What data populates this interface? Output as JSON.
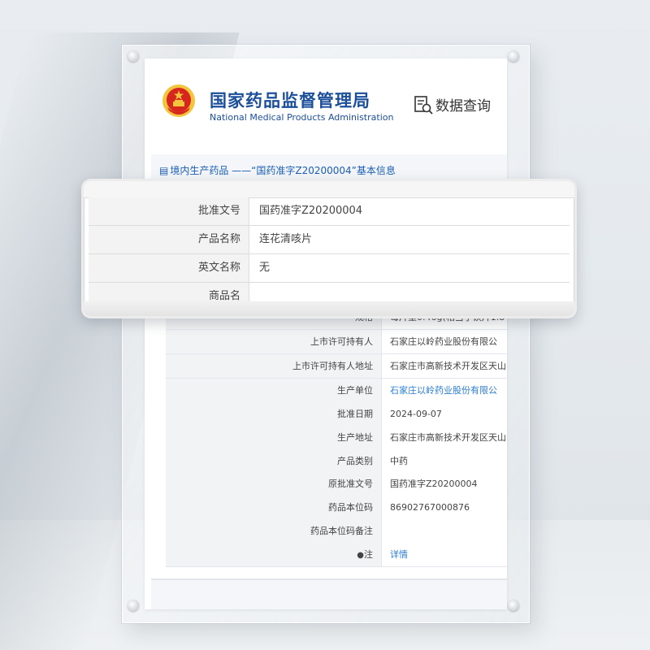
{
  "header": {
    "title_cn": "国家药品监督管理局",
    "title_en": "National Medical Products Administration",
    "query_label": "数据查询",
    "emblem_icon": "national-emblem-icon",
    "query_icon": "document-search-icon"
  },
  "breadcrumb": {
    "text": "境内生产药品 ——“国药准字Z20200004”基本信息",
    "icon": "document-icon"
  },
  "magnified": {
    "rows": [
      {
        "label": "批准文号",
        "value": "国药准字Z20200004"
      },
      {
        "label": "产品名称",
        "value": "连花清咳片"
      },
      {
        "label": "英文名称",
        "value": "无"
      },
      {
        "label": "商品名",
        "value": ""
      }
    ]
  },
  "table": {
    "rows": [
      {
        "label": "规格",
        "value": "每片重0.46g(相当于饮片1.8"
      },
      {
        "label": "上市许可持有人",
        "value": "石家庄以岭药业股份有限公"
      },
      {
        "label": "上市许可持有人地址",
        "value": "石家庄市高新技术开发区天山"
      },
      {
        "label": "生产单位",
        "value": "石家庄以岭药业股份有限公"
      },
      {
        "label": "批准日期",
        "value": "2024-09-07"
      },
      {
        "label": "生产地址",
        "value": "石家庄市高新技术开发区天山"
      },
      {
        "label": "产品类别",
        "value": "中药"
      },
      {
        "label": "原批准文号",
        "value": "国药准字Z20200004"
      },
      {
        "label": "药品本位码",
        "value": "86902767000876"
      },
      {
        "label": "药品本位码备注",
        "value": ""
      },
      {
        "label": "注",
        "value": "详情"
      }
    ]
  },
  "colors": {
    "brand_blue": "#1b4f9a",
    "link_blue": "#2a7ed3",
    "emblem_red": "#d7261e",
    "emblem_gold": "#f2c53d"
  }
}
